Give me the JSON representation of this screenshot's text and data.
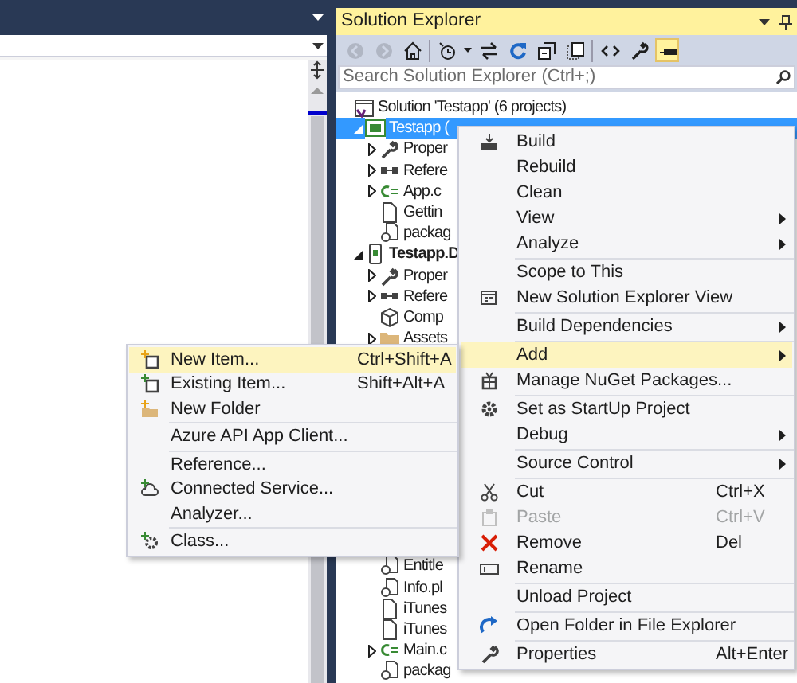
{
  "solution_explorer": {
    "title": "Solution Explorer",
    "toolbar": [
      {
        "kind": "back",
        "disabled": true,
        "selected": false
      },
      {
        "kind": "forward",
        "disabled": true,
        "selected": false
      },
      {
        "kind": "home",
        "disabled": false,
        "selected": false
      },
      {
        "kind": "separator"
      },
      {
        "kind": "history",
        "disabled": false,
        "selected": false
      },
      {
        "kind": "sync",
        "disabled": false,
        "selected": false
      },
      {
        "kind": "refresh",
        "disabled": false,
        "selected": false
      },
      {
        "kind": "collapse",
        "disabled": false,
        "selected": false
      },
      {
        "kind": "showall",
        "disabled": false,
        "selected": false
      },
      {
        "kind": "separator"
      },
      {
        "kind": "code",
        "disabled": false,
        "selected": false
      },
      {
        "kind": "properties",
        "disabled": false,
        "selected": false
      },
      {
        "kind": "preview",
        "disabled": false,
        "selected": true
      }
    ],
    "search": {
      "placeholder": "Search Solution Explorer (Ctrl+;)"
    },
    "tree": [
      {
        "label": "Solution 'Testapp' (6 projects)",
        "kind": "solution",
        "selected": false,
        "children": [
          {
            "label": "Testapp (",
            "kind": "csproject",
            "selected": true,
            "expanded": true,
            "children": [
              {
                "label": "Proper",
                "kind": "wrench",
                "selected": false,
                "expanded": false
              },
              {
                "label": "Refere",
                "kind": "references",
                "selected": false,
                "expanded": false
              },
              {
                "label": "App.c",
                "kind": "csfile",
                "selected": false,
                "expanded": false
              },
              {
                "label": "Gettin",
                "kind": "file",
                "selected": false
              },
              {
                "label": "packag",
                "kind": "config",
                "selected": false
              }
            ]
          },
          {
            "label": "Testapp.D",
            "kind": "device",
            "selected": false,
            "expanded": true,
            "bold": true,
            "children": [
              {
                "label": "Proper",
                "kind": "wrench",
                "selected": false,
                "expanded": false
              },
              {
                "label": "Refere",
                "kind": "references",
                "selected": false,
                "expanded": false
              },
              {
                "label": "Comp",
                "kind": "component",
                "selected": false
              },
              {
                "label": "Assets",
                "kind": "folder",
                "selected": false,
                "expanded": false
              },
              {
                "label": "Entitle",
                "kind": "config",
                "selected": false,
                "gap_before": true
              },
              {
                "label": "Info.pl",
                "kind": "config",
                "selected": false
              },
              {
                "label": "iTunes",
                "kind": "file",
                "selected": false
              },
              {
                "label": "iTunes",
                "kind": "file",
                "selected": false
              },
              {
                "label": "Main.c",
                "kind": "csfile",
                "selected": false,
                "expanded": false
              },
              {
                "label": "packag",
                "kind": "config",
                "selected": false
              }
            ]
          }
        ]
      }
    ]
  },
  "context_menu": {
    "items": [
      {
        "kind": "build",
        "label": "Build",
        "selected": false,
        "disabled": false,
        "submenu": false
      },
      {
        "kind": "plain",
        "label": "Rebuild",
        "selected": false,
        "disabled": false,
        "submenu": false
      },
      {
        "kind": "plain",
        "label": "Clean",
        "selected": false,
        "disabled": false,
        "submenu": false
      },
      {
        "kind": "plain",
        "label": "View",
        "selected": false,
        "disabled": false,
        "submenu": true
      },
      {
        "kind": "plain",
        "label": "Analyze",
        "selected": false,
        "disabled": false,
        "submenu": true
      },
      {
        "kind": "separator"
      },
      {
        "kind": "plain",
        "label": "Scope to This",
        "selected": false,
        "disabled": false,
        "submenu": false
      },
      {
        "kind": "newview",
        "label": "New Solution Explorer View",
        "selected": false,
        "disabled": false,
        "submenu": false
      },
      {
        "kind": "separator"
      },
      {
        "kind": "plain",
        "label": "Build Dependencies",
        "selected": false,
        "disabled": false,
        "submenu": true
      },
      {
        "kind": "separator"
      },
      {
        "kind": "plain",
        "label": "Add",
        "selected": true,
        "disabled": false,
        "submenu": true
      },
      {
        "kind": "nuget",
        "label": "Manage NuGet Packages...",
        "selected": false,
        "disabled": false,
        "submenu": false
      },
      {
        "kind": "separator"
      },
      {
        "kind": "startup",
        "label": "Set as StartUp Project",
        "selected": false,
        "disabled": false,
        "submenu": false
      },
      {
        "kind": "plain",
        "label": "Debug",
        "selected": false,
        "disabled": false,
        "submenu": true
      },
      {
        "kind": "separator"
      },
      {
        "kind": "plain",
        "label": "Source Control",
        "selected": false,
        "disabled": false,
        "submenu": true
      },
      {
        "kind": "separator"
      },
      {
        "kind": "cut",
        "label": "Cut",
        "shortcut": "Ctrl+X",
        "selected": false,
        "disabled": false,
        "submenu": false
      },
      {
        "kind": "paste",
        "label": "Paste",
        "shortcut": "Ctrl+V",
        "selected": false,
        "disabled": true,
        "submenu": false
      },
      {
        "kind": "remove",
        "label": "Remove",
        "shortcut": "Del",
        "selected": false,
        "disabled": false,
        "submenu": false
      },
      {
        "kind": "rename",
        "label": "Rename",
        "selected": false,
        "disabled": false,
        "submenu": false
      },
      {
        "kind": "separator"
      },
      {
        "kind": "plain",
        "label": "Unload Project",
        "selected": false,
        "disabled": false,
        "submenu": false
      },
      {
        "kind": "separator"
      },
      {
        "kind": "openfolder",
        "label": "Open Folder in File Explorer",
        "selected": false,
        "disabled": false,
        "submenu": false
      },
      {
        "kind": "separator"
      },
      {
        "kind": "properties",
        "label": "Properties",
        "shortcut": "Alt+Enter",
        "selected": false,
        "disabled": false,
        "submenu": false
      }
    ]
  },
  "add_submenu": {
    "items": [
      {
        "kind": "newitem",
        "label": "New Item...",
        "shortcut": "Ctrl+Shift+A",
        "selected": true,
        "disabled": false
      },
      {
        "kind": "existingitem",
        "label": "Existing Item...",
        "shortcut": "Shift+Alt+A",
        "selected": false,
        "disabled": false
      },
      {
        "kind": "newfolder",
        "label": "New Folder",
        "selected": false,
        "disabled": false
      },
      {
        "kind": "separator"
      },
      {
        "kind": "plain",
        "label": "Azure API App Client...",
        "selected": false,
        "disabled": false
      },
      {
        "kind": "separator"
      },
      {
        "kind": "plain",
        "label": "Reference...",
        "selected": false,
        "disabled": false
      },
      {
        "kind": "connected",
        "label": "Connected Service...",
        "selected": false,
        "disabled": false
      },
      {
        "kind": "plain",
        "label": "Analyzer...",
        "selected": false,
        "disabled": false
      },
      {
        "kind": "separator"
      },
      {
        "kind": "class",
        "label": "Class...",
        "selected": false,
        "disabled": false
      }
    ]
  }
}
